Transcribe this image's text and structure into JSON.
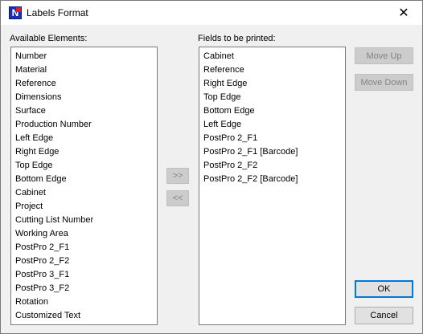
{
  "window": {
    "title": "Labels Format",
    "close_glyph": "✕",
    "app_icon_letter": "N"
  },
  "available": {
    "label": "Available Elements:",
    "items": [
      "Number",
      "Material",
      "Reference",
      "Dimensions",
      "Surface",
      "Production Number",
      "Left Edge",
      "Right Edge",
      "Top Edge",
      "Bottom Edge",
      "Cabinet",
      "Project",
      "Cutting List Number",
      "Working Area",
      "PostPro 2_F1",
      "PostPro 2_F2",
      "PostPro 3_F1",
      "PostPro 3_F2",
      "Rotation",
      "Customized Text"
    ]
  },
  "printed": {
    "label": "Fields to be printed:",
    "items": [
      "Cabinet",
      "Reference",
      "Right Edge",
      "Top Edge",
      "Bottom Edge",
      "Left Edge",
      "PostPro 2_F1",
      "PostPro 2_F1 [Barcode]",
      "PostPro 2_F2",
      "PostPro 2_F2 [Barcode]"
    ]
  },
  "buttons": {
    "add": ">>",
    "remove": "<<",
    "move_up": "Move Up",
    "move_down": "Move Down",
    "ok": "OK",
    "cancel": "Cancel"
  }
}
